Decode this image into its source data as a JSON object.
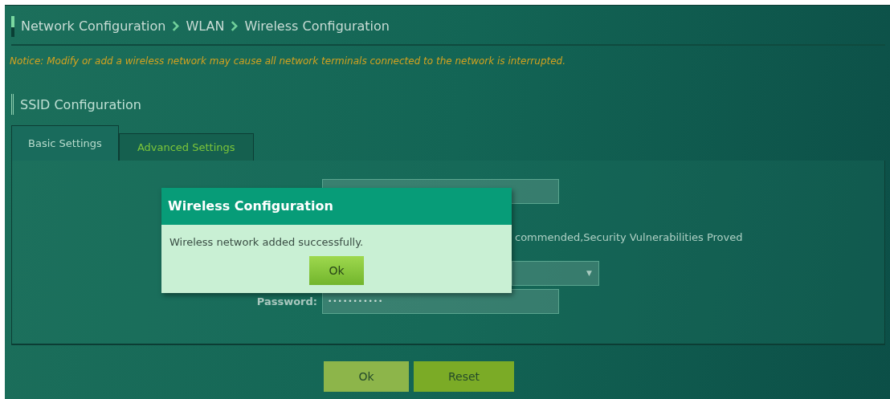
{
  "breadcrumb": {
    "items": [
      "Network Configuration",
      "WLAN",
      "Wireless Configuration"
    ]
  },
  "notice": "Notice: Modify or add a wireless network may cause all network terminals connected to the network is interrupted.",
  "section_title": "SSID Configuration",
  "tabs": [
    {
      "label": "Basic Settings",
      "selected": true
    },
    {
      "label": "Advanced Settings",
      "selected": false
    }
  ],
  "form": {
    "security_note": "commended,Security Vulnerabilities Proved",
    "dropdown_caret": "▼",
    "password_label": "Password:",
    "password_value": "•••••••••••"
  },
  "buttons": [
    {
      "label": "Ok",
      "kind": "primary"
    },
    {
      "label": "Reset",
      "kind": "secondary"
    }
  ],
  "dialog": {
    "title": "Wireless Configuration",
    "message": "Wireless network added successfully.",
    "button": "Ok"
  }
}
